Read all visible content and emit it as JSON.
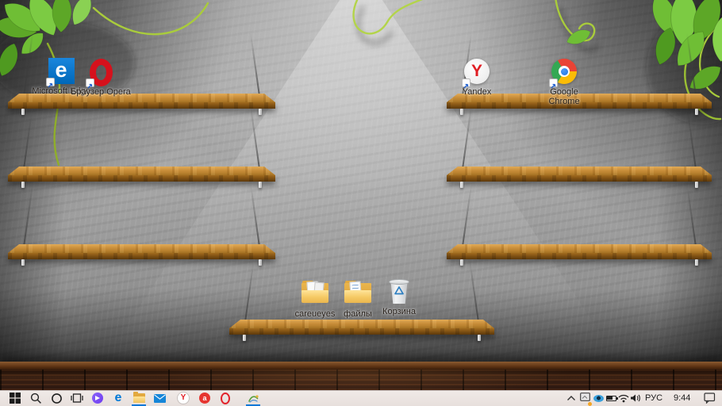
{
  "desktop": {
    "icons": [
      {
        "id": "microsoft-edge",
        "label": "Microsoft Edge"
      },
      {
        "id": "opera",
        "label": "Браузер Opera"
      },
      {
        "id": "yandex",
        "label": "Yandex"
      },
      {
        "id": "google-chrome",
        "label": "Google Chrome"
      },
      {
        "id": "careueyes-folder",
        "label": "careueyes"
      },
      {
        "id": "files-folder",
        "label": "файлы"
      },
      {
        "id": "recycle-bin",
        "label": "Корзина"
      }
    ]
  },
  "taskbar": {
    "left_icons": [
      "start",
      "search",
      "cortana",
      "task-view"
    ],
    "pinned_icons": [
      "yandex-alice",
      "microsoft-edge",
      "file-explorer",
      "mail",
      "yandex-browser",
      "red-app",
      "opera",
      "careueyes"
    ],
    "active_icons": [
      "file-explorer",
      "careueyes"
    ],
    "tray_icons": [
      "hidden-icons-chevron",
      "tablet-notification",
      "careueyes-eye",
      "battery",
      "wifi",
      "volume",
      "action-center"
    ],
    "language": "РУС",
    "time": "9:44"
  },
  "icon_glyphs": {
    "edge_letter": "e",
    "yandex_letter": "Y",
    "red_app_letter": "a"
  },
  "colors": {
    "accent": "#0078d7",
    "taskbar_bg": "#ebe4e0",
    "shelf_wood": "#c98e3a",
    "floor_wood": "#2b1710",
    "leaf_green": "#6fbe35",
    "vine_green": "#a9cc3b"
  }
}
